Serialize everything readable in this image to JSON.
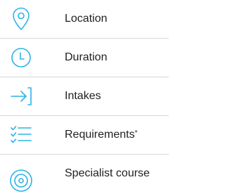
{
  "accent_color": "#2bb3e6",
  "items": [
    {
      "label": "Location",
      "icon": "location-pin-icon"
    },
    {
      "label": "Duration",
      "icon": "clock-icon"
    },
    {
      "label": "Intakes",
      "icon": "arrow-into-bracket-icon"
    },
    {
      "label": "Requirements",
      "footnote_mark": "*",
      "icon": "checklist-icon"
    },
    {
      "label": "Specialist course",
      "icon": "target-icon"
    }
  ]
}
